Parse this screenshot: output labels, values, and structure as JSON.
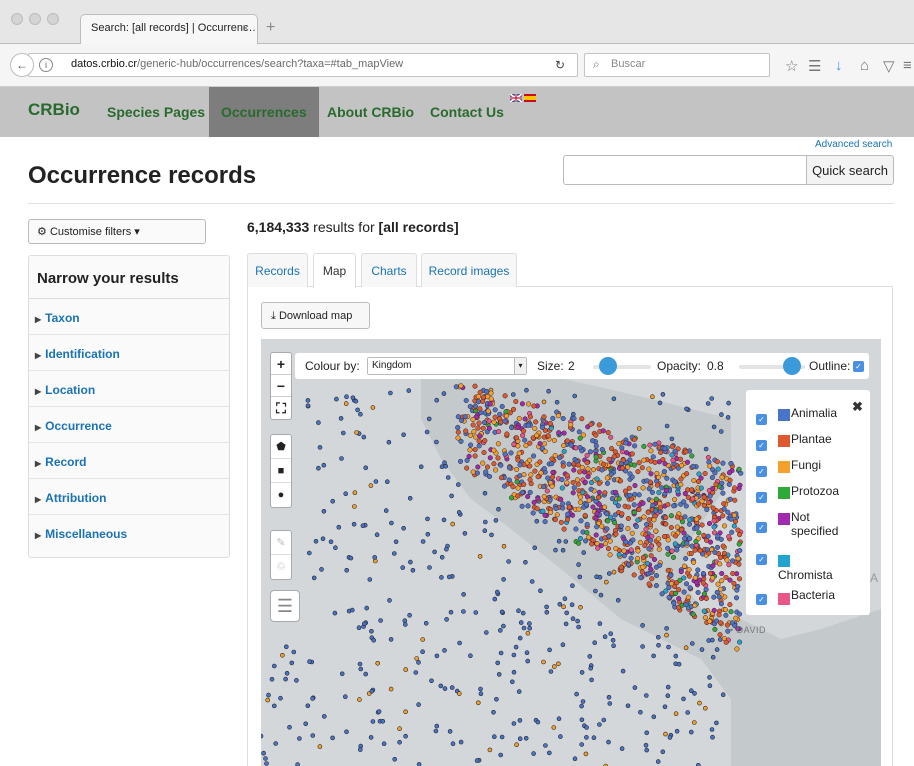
{
  "browser": {
    "tab_title": "Search: [all records] | Occurrenc…",
    "tab_close": "×",
    "new_tab": "+",
    "url_domain": "datos.crbio.cr",
    "url_path": "/generic-hub/occurrences/search?taxa=#tab_mapView",
    "search_placeholder": "Buscar"
  },
  "site": {
    "brand": "CRBio",
    "nav": [
      {
        "label": "Species Pages"
      },
      {
        "label": "Occurrences",
        "active": true
      },
      {
        "label": "About CRBio"
      },
      {
        "label": "Contact Us"
      }
    ],
    "languages": [
      "English",
      "Español"
    ]
  },
  "search": {
    "advanced_label": "Advanced search",
    "quick_search_label": "Quick search",
    "query": ""
  },
  "page": {
    "title": "Occurrence records",
    "customise_label": "Customise filters",
    "results_count": "6,184,333",
    "results_mid": " results for ",
    "results_query": "[all records]"
  },
  "facets": {
    "heading": "Narrow your results",
    "items": [
      "Taxon",
      "Identification",
      "Location",
      "Occurrence",
      "Record",
      "Attribution",
      "Miscellaneous"
    ]
  },
  "tabs": [
    {
      "label": "Records"
    },
    {
      "label": "Map",
      "active": true
    },
    {
      "label": "Charts"
    },
    {
      "label": "Record images"
    }
  ],
  "map": {
    "download_label": "Download map",
    "colour_by_label": "Colour by:",
    "colour_by_value": "Kingdom",
    "size_label": "Size:",
    "size_value": 2,
    "opacity_label": "Opacity:",
    "opacity_value": 0.8,
    "outline_label": "Outline:",
    "outline_checked": true,
    "place_label_david": "• DAVID",
    "place_label_pa": "A",
    "legend": [
      {
        "label": "Animalia",
        "color": "#4a74c9",
        "checked": true
      },
      {
        "label": "Plantae",
        "color": "#dc5a2e",
        "checked": true
      },
      {
        "label": "Fungi",
        "color": "#f4a02c",
        "checked": true
      },
      {
        "label": "Protozoa",
        "color": "#2eaa3a",
        "checked": true
      },
      {
        "label": "Not specified",
        "color": "#a02ab0",
        "checked": true
      },
      {
        "label": "Chromista",
        "color": "#22a4cf",
        "checked": true
      },
      {
        "label": "Bacteria",
        "color": "#e8568a",
        "checked": true
      }
    ]
  },
  "colors": {
    "brand_green": "#2a6a2e",
    "link_blue": "#1a73b5",
    "nav_bg": "#c3c3c3",
    "nav_active_bg": "#7d7d7d",
    "slider_blue": "#3b9ad9",
    "land": "#c4c9cc",
    "sea": "#d3d7da"
  },
  "icons": {
    "back": "left-arrow-icon",
    "info": "info-icon",
    "reload": "reload-icon",
    "search": "magnifier-icon",
    "bookmark": "star-icon",
    "reading_list": "reading-list-icon",
    "downloads": "download-arrow-icon",
    "home": "home-icon",
    "pocket": "pocket-icon",
    "menu": "hamburger-icon",
    "customise": "gear-icon",
    "download_map": "download-tray-icon",
    "zoom_in": "plus-icon",
    "zoom_out": "minus-icon",
    "fullscreen": "fullscreen-icon",
    "polygon": "polygon-icon",
    "rectangle": "rectangle-icon",
    "circle": "circle-icon",
    "edit": "edit-icon",
    "delete": "trash-icon",
    "layers": "layers-icon",
    "legend_close": "close-icon"
  }
}
